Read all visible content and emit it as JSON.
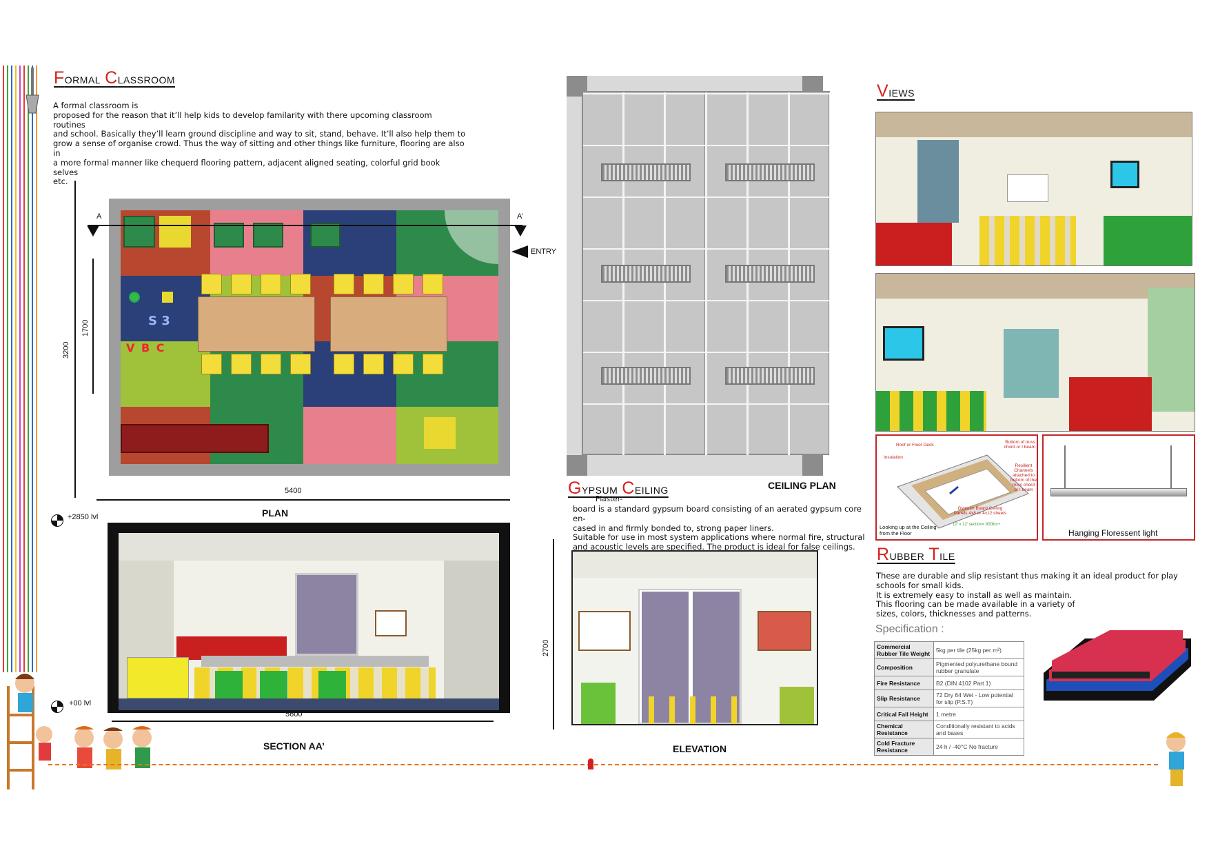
{
  "formal_classroom": {
    "title_cap1": "F",
    "title_rest1": "ormal ",
    "title_cap2": "C",
    "title_rest2": "lassroom",
    "description_line1": "A  formal  classroom  is",
    "description_line2": "proposed for the reason that it’ll help kids to develop familarity with there upcoming classroom routines",
    "description_line3": "and school. Basically they’ll learn ground discipline and way to sit, stand, behave. It’ll also help them to",
    "description_line4": "grow a sense of organise crowd.  Thus the way of sitting and other things like furniture, flooring are also in",
    "description_line5": "a more formal manner like chequerd flooring pattern, adjacent aligned seating, colorful grid book selves",
    "description_line6": "etc."
  },
  "plan": {
    "label": "PLAN",
    "dim_width": "5400",
    "dim_depth": "3200",
    "dim_inner": "1700",
    "section_mark_left": "A",
    "section_mark_right": "A’",
    "entry_label": "ENTRY",
    "floor_letters_1": "S 3",
    "floor_letters_2": "V B C"
  },
  "section": {
    "label": "SECTION AA’",
    "dim_width": "5600",
    "level_top": "+2850 lvl",
    "level_bottom": "+00 lvl"
  },
  "ceiling_plan": {
    "label": "CEILING PLAN"
  },
  "gypsum": {
    "title_cap1": "G",
    "title_rest1": "ypsum ",
    "title_cap2": "C",
    "title_rest2": "eiling",
    "plaster_word": "Plaster-",
    "line1": "board is a standard gypsum board consisting of an aerated gypsum core en-",
    "line2": "cased in and firmly bonded to, strong paper liners.",
    "line3": "Suitable for use in most system applications where normal fire, structural",
    "line4": "and acoustic levels are specified. The product is ideal for false ceilings."
  },
  "elevation": {
    "label": "ELEVATION",
    "dim_height": "2700"
  },
  "views": {
    "title_cap": "V",
    "title_rest": "iews"
  },
  "ceiling_detail": {
    "roof_label": "Roof or Floor Deck",
    "bottom_label": "Bottom of truss chord or I beam",
    "insulation_label": "Insulation",
    "resilient_label": "Resilient Channels attached to bottom of the truss chord or I beam",
    "panel_label": "Gypsum Board Ceiling Panels 4x8 or 4x12 sheets",
    "section_label": "12' x 12' section= 800lbs+",
    "looking_label": "Looking up at the Ceiling from the Floor",
    "light_label": "Hanging Floressent light"
  },
  "rubber_tile": {
    "title_cap1": "R",
    "title_rest1": "ubber ",
    "title_cap2": "T",
    "title_rest2": "ile",
    "line1": "These are durable and slip resistant thus making it an ideal product for play",
    "line2": "schools for small kids.",
    "line3": "It is extremely easy to install as well as maintain.",
    "line4": "This flooring can be made available in a variety of",
    "line5": "sizes, colors, thicknesses and patterns.",
    "spec_heading": "Specification :",
    "spec_rows": [
      {
        "key": "Commercial Rubber Tile Weight",
        "value": "5kg per tile (25kg per m²)"
      },
      {
        "key": "Composition",
        "value": "Pigmented polyurethane bound rubber granulate"
      },
      {
        "key": "Fire Resistance",
        "value": "B2 (DIN 4102 Part 1)"
      },
      {
        "key": "Slip Resistance",
        "value": "72 Dry 64 Wet - Low potential for slip (P.S.T)"
      },
      {
        "key": "Critical Fall Height",
        "value": "1 metre"
      },
      {
        "key": "Chemical Resistance",
        "value": "Conditionally resistant to acids and bases"
      },
      {
        "key": "Cold Fracture Resistance",
        "value": "24 h / -40°C No fracture"
      }
    ]
  },
  "colors": {
    "accent_red": "#d61f1f",
    "rope_orange": "#e8751a"
  }
}
